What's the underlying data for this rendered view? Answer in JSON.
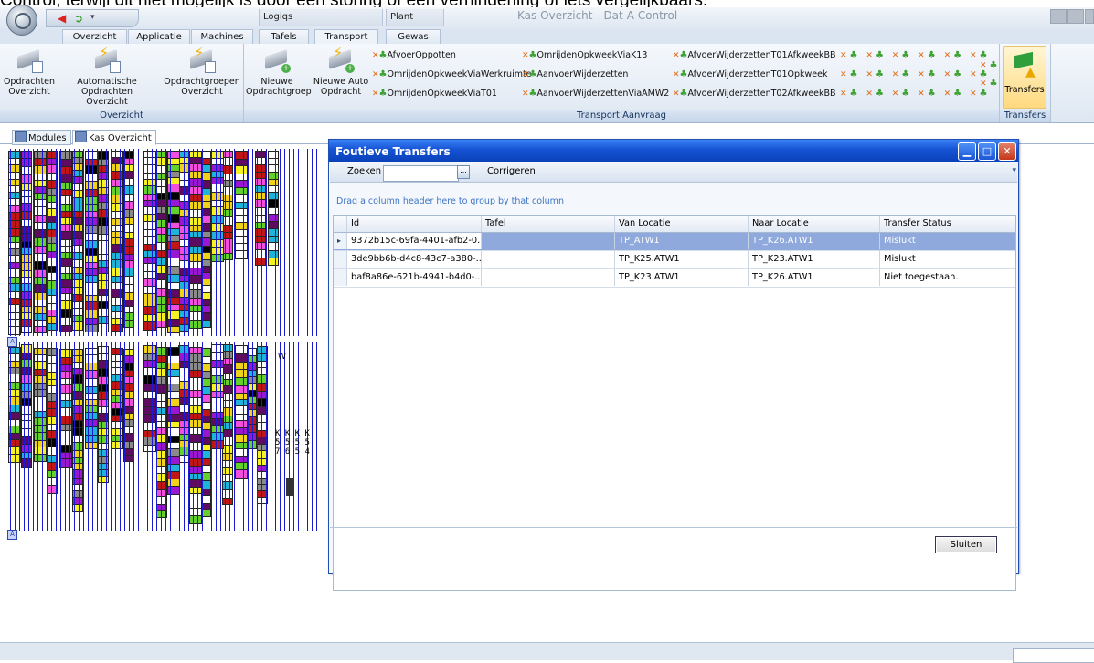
{
  "caption": "Control, terwijl dit niet mogelijk is door een storing of een verhinderling of iets vergelijkbaars.",
  "window": {
    "title": "Kas Overzicht - Dat-A Control",
    "context_tabs": [
      "Logiqs",
      "Plant"
    ]
  },
  "ribbon_tabs": [
    "Overzicht",
    "Applicatie",
    "Machines",
    "Tafels",
    "Transport",
    "Gewas"
  ],
  "active_ribbon_tab": "Transport",
  "ribbon": {
    "overzicht_group": {
      "label": "Overzicht",
      "buttons": [
        {
          "line1": "Opdrachten",
          "line2": "Overzicht"
        },
        {
          "line1": "Automatische",
          "line2": "Opdrachten Overzicht"
        },
        {
          "line1": "Opdrachtgroepen",
          "line2": "Overzicht"
        }
      ]
    },
    "transport_group": {
      "label": "Transport Aanvraag",
      "buttons": [
        {
          "line1": "Nieuwe",
          "line2": "Opdrachtgroep"
        },
        {
          "line1": "Nieuwe Auto",
          "line2": "Opdracht"
        }
      ],
      "col1": [
        "AfvoerOppotten",
        "OmrijdenOpkweekViaWerkruimte",
        "OmrijdenOpkweekViaT01"
      ],
      "col2": [
        "OmrijdenOpkweekViaK13",
        "AanvoerWijderzetten",
        "AanvoerWijderzettenViaAMW2"
      ],
      "col3": [
        "AfvoerWijderzettenT01AfkweekBB",
        "AfvoerWijderzettenT01Opkweek",
        "AfvoerWijderzettenT02AfkweekBB"
      ]
    },
    "transfers_group": {
      "label": "Transfers",
      "button": "Transfers"
    }
  },
  "doc_tabs": [
    "Modules",
    "Kas Overzicht"
  ],
  "map_labels": {
    "row1": "K K K K",
    "row2": "5 5 5 5",
    "row3": "7 6 5 4",
    "w": "W"
  },
  "dialog": {
    "title": "Foutieve Transfers",
    "search_label": "Zoeken",
    "search_value": "",
    "dots": "...",
    "correct_label": "Corrigeren",
    "group_hint": "Drag a column header here to group by that column",
    "columns": [
      "Id",
      "Tafel",
      "Van Locatie",
      "Naar Locatie",
      "Transfer Status"
    ],
    "rows": [
      {
        "id": "9372b15c-69fa-4401-afb2-0...",
        "tafel": "",
        "van": "TP_ATW1",
        "naar": "TP_K26.ATW1",
        "status": "Mislukt"
      },
      {
        "id": "3de9bb6b-d4c8-43c7-a380-...",
        "tafel": "",
        "van": "TP_K25.ATW1",
        "naar": "TP_K23.ATW1",
        "status": "Mislukt"
      },
      {
        "id": "baf8a86e-621b-4941-b4d0-...",
        "tafel": "",
        "van": "TP_K23.ATW1",
        "naar": "TP_K26.ATW1",
        "status": "Niet toegestaan."
      }
    ],
    "close_button": "Sluiten"
  },
  "colors": {
    "title_blue": "#1553d4",
    "selected_row": "#8fa9dc",
    "map_blue": "#1a1ad0",
    "map_colors": [
      "#f7f224",
      "#1fb3d9",
      "#9a17d1",
      "#c01616",
      "#63d12a",
      "#5d0a61",
      "#8a8a8a",
      "#f0d21a",
      "#f24fdc",
      "#000000",
      "#ffffff"
    ]
  },
  "icons": [
    "app-orb-icon",
    "transport-truck-icon",
    "transfer-arrow-icon",
    "transfers-warning-icon",
    "minimize-icon",
    "maximize-icon",
    "close-icon"
  ]
}
